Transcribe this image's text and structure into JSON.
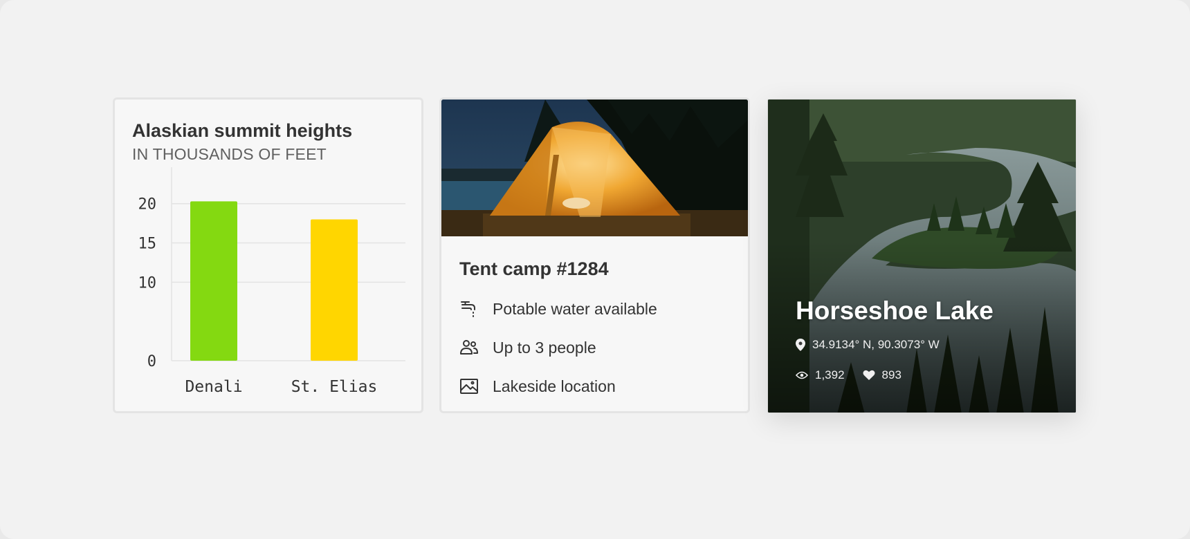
{
  "chart_card": {
    "title": "Alaskian summit heights",
    "subtitle": "IN THOUSANDS OF FEET"
  },
  "chart_data": {
    "type": "bar",
    "title": "Alaskian summit heights",
    "subtitle": "IN THOUSANDS OF FEET",
    "categories": [
      "Denali",
      "St. Elias"
    ],
    "values": [
      20.3,
      18.0
    ],
    "yticks": [
      0,
      10,
      15,
      20
    ],
    "ylim": [
      0,
      22
    ],
    "bar_colors": [
      "#84d911",
      "#ffd600"
    ],
    "grid": true
  },
  "camp_card": {
    "title": "Tent camp #1284",
    "features": [
      {
        "icon": "faucet-icon",
        "label": "Potable water available"
      },
      {
        "icon": "people-icon",
        "label": "Up to 3 people"
      },
      {
        "icon": "landscape-icon",
        "label": "Lakeside location"
      }
    ]
  },
  "lake_card": {
    "title": "Horseshoe Lake",
    "coordinates": "34.9134° N, 90.3073° W",
    "views": "1,392",
    "likes": "893"
  }
}
